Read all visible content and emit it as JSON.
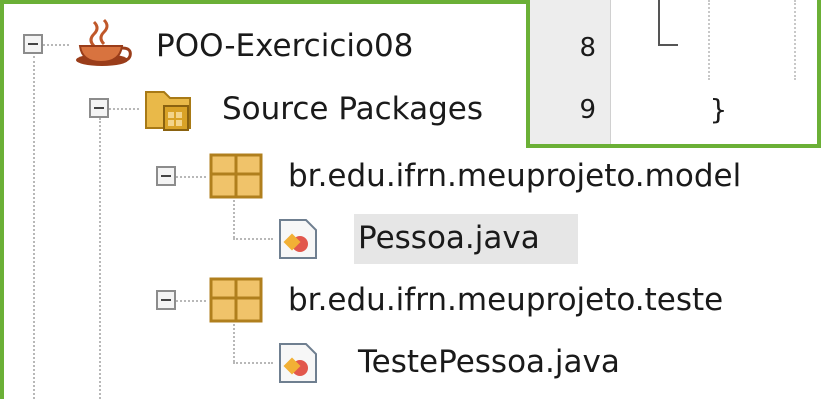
{
  "colors": {
    "highlight_border": "#6bb036",
    "selection": "#e6e6e6"
  },
  "project_tree": {
    "project": {
      "label": "POO-Exercicio08",
      "icon": "coffee-cup-icon"
    },
    "source_packages": {
      "label": "Source Packages",
      "icon": "source-packages-folder-icon"
    },
    "packages": [
      {
        "label": "br.edu.ifrn.meuprojeto.model",
        "icon": "package-icon",
        "files": [
          {
            "label": "Pessoa.java",
            "icon": "java-class-icon",
            "selected": true
          }
        ]
      },
      {
        "label": "br.edu.ifrn.meuprojeto.teste",
        "icon": "package-icon",
        "files": [
          {
            "label": "TestePessoa.java",
            "icon": "java-class-icon",
            "selected": false
          }
        ]
      }
    ]
  },
  "editor": {
    "line_numbers": [
      "8",
      "9"
    ],
    "code_line_9": "}"
  }
}
